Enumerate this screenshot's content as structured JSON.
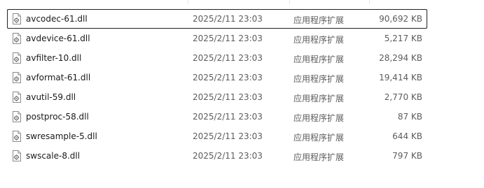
{
  "files": [
    {
      "name": "avcodec-61.dll",
      "date": "2025/2/11 23:03",
      "type": "应用程序扩展",
      "size": "90,692 KB",
      "selected": true,
      "icon": "dll-file-icon"
    },
    {
      "name": "avdevice-61.dll",
      "date": "2025/2/11 23:03",
      "type": "应用程序扩展",
      "size": "5,217 KB",
      "selected": false,
      "icon": "dll-file-icon"
    },
    {
      "name": "avfilter-10.dll",
      "date": "2025/2/11 23:03",
      "type": "应用程序扩展",
      "size": "28,294 KB",
      "selected": false,
      "icon": "dll-file-icon"
    },
    {
      "name": "avformat-61.dll",
      "date": "2025/2/11 23:03",
      "type": "应用程序扩展",
      "size": "19,414 KB",
      "selected": false,
      "icon": "dll-file-icon"
    },
    {
      "name": "avutil-59.dll",
      "date": "2025/2/11 23:03",
      "type": "应用程序扩展",
      "size": "2,770 KB",
      "selected": false,
      "icon": "dll-file-icon"
    },
    {
      "name": "postproc-58.dll",
      "date": "2025/2/11 23:03",
      "type": "应用程序扩展",
      "size": "87 KB",
      "selected": false,
      "icon": "dll-file-icon"
    },
    {
      "name": "swresample-5.dll",
      "date": "2025/2/11 23:03",
      "type": "应用程序扩展",
      "size": "644 KB",
      "selected": false,
      "icon": "dll-file-icon"
    },
    {
      "name": "swscale-8.dll",
      "date": "2025/2/11 23:03",
      "type": "应用程序扩展",
      "size": "797 KB",
      "selected": false,
      "icon": "dll-file-icon"
    }
  ]
}
